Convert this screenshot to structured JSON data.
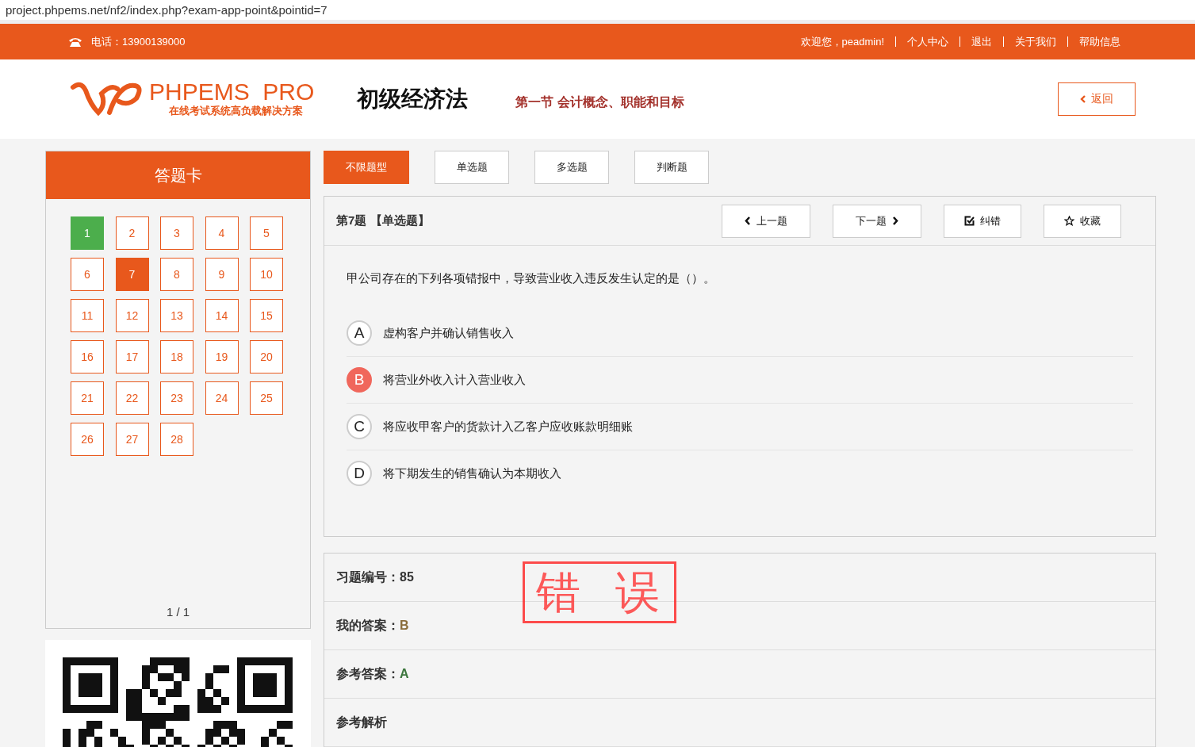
{
  "address_bar": {
    "url": "project.phpems.net/nf2/index.php?exam-app-point&pointid=7"
  },
  "top_bar": {
    "phone": "电话：13900139000",
    "links": [
      "欢迎您，peadmin!",
      "个人中心",
      "退出",
      "关于我们",
      "帮助信息"
    ]
  },
  "header": {
    "logo_name": "PHPEMS  PRO",
    "logo_slogan": "在线考试系统高负载解决方案",
    "subject": "初级经济法",
    "section": "第一节 会计概念、职能和目标",
    "back_button": "返回"
  },
  "answer_card": {
    "title": "答题卡",
    "pager": "1 / 1",
    "items": [
      {
        "label": "1",
        "kind": "answered"
      },
      {
        "label": "2",
        "kind": "open"
      },
      {
        "label": "3",
        "kind": "open"
      },
      {
        "label": "4",
        "kind": "open"
      },
      {
        "label": "5",
        "kind": "open"
      },
      {
        "label": "6",
        "kind": "open"
      },
      {
        "label": "7",
        "kind": "current"
      },
      {
        "label": "8",
        "kind": "open"
      },
      {
        "label": "9",
        "kind": "open"
      },
      {
        "label": "10",
        "kind": "open"
      },
      {
        "label": "11",
        "kind": "open"
      },
      {
        "label": "12",
        "kind": "open"
      },
      {
        "label": "13",
        "kind": "open"
      },
      {
        "label": "14",
        "kind": "open"
      },
      {
        "label": "15",
        "kind": "open"
      },
      {
        "label": "16",
        "kind": "open"
      },
      {
        "label": "17",
        "kind": "open"
      },
      {
        "label": "18",
        "kind": "open"
      },
      {
        "label": "19",
        "kind": "open"
      },
      {
        "label": "20",
        "kind": "open"
      },
      {
        "label": "21",
        "kind": "open"
      },
      {
        "label": "22",
        "kind": "open"
      },
      {
        "label": "23",
        "kind": "open"
      },
      {
        "label": "24",
        "kind": "open"
      },
      {
        "label": "25",
        "kind": "open"
      },
      {
        "label": "26",
        "kind": "open"
      },
      {
        "label": "27",
        "kind": "open"
      },
      {
        "label": "28",
        "kind": "open"
      }
    ]
  },
  "tabs": [
    {
      "label": "不限题型",
      "selected": true
    },
    {
      "label": "单选题",
      "selected": false
    },
    {
      "label": "多选题",
      "selected": false
    },
    {
      "label": "判断题",
      "selected": false
    }
  ],
  "question": {
    "title": "第7题 【单选题】",
    "buttons": [
      {
        "label": "上一题",
        "kind": "prev"
      },
      {
        "label": "下一题",
        "kind": "next"
      },
      {
        "label": "纠错",
        "kind": "report"
      },
      {
        "label": "收藏",
        "kind": "favorite"
      }
    ],
    "text": "甲公司存在的下列各项错报中，导致营业收入违反发生认定的是（）。",
    "options": [
      {
        "letter": "A",
        "text": "虚构客户并确认销售收入",
        "selected": false
      },
      {
        "letter": "B",
        "text": "将营业外收入计入营业收入",
        "selected": true
      },
      {
        "letter": "C",
        "text": "将应收甲客户的货款计入乙客户应收账款明细账",
        "selected": false
      },
      {
        "letter": "D",
        "text": "将下期发生的销售确认为本期收入",
        "selected": false
      }
    ]
  },
  "result": {
    "stamp": "错误",
    "rows": [
      {
        "label": "习题编号：",
        "value": "85",
        "kind": "number"
      },
      {
        "label": "我的答案：",
        "value": "B",
        "kind": "mine"
      },
      {
        "label": "参考答案：",
        "value": "A",
        "kind": "correct"
      },
      {
        "label": "参考解析"
      }
    ]
  }
}
